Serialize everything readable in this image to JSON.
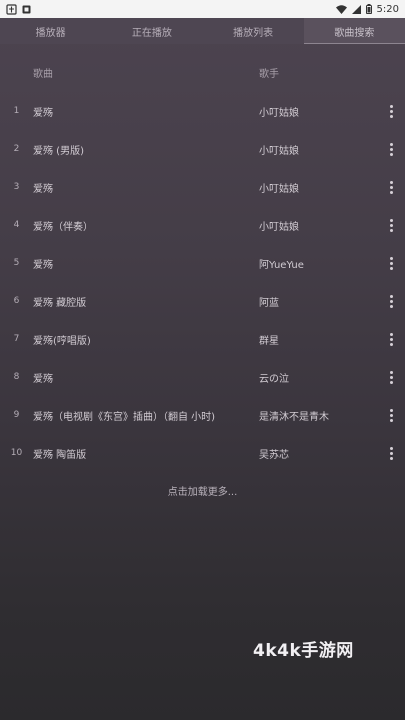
{
  "status": {
    "time": "5:20"
  },
  "tabs": [
    {
      "label": "播放器"
    },
    {
      "label": "正在播放"
    },
    {
      "label": "播放列表"
    },
    {
      "label": "歌曲搜索"
    }
  ],
  "columns": {
    "title": "歌曲",
    "artist": "歌手"
  },
  "rows": [
    {
      "index": "1",
      "title": "爱殇",
      "artist": "小叮姑娘"
    },
    {
      "index": "2",
      "title": "爱殇 (男版)",
      "artist": "小叮姑娘"
    },
    {
      "index": "3",
      "title": "爱殇",
      "artist": "小叮姑娘"
    },
    {
      "index": "4",
      "title": "爱殇（伴奏）",
      "artist": "小叮姑娘"
    },
    {
      "index": "5",
      "title": "爱殇",
      "artist": "阿YueYue"
    },
    {
      "index": "6",
      "title": "爱殇 藏腔版",
      "artist": "阿蓝"
    },
    {
      "index": "7",
      "title": "爱殇(哼唱版)",
      "artist": "群星"
    },
    {
      "index": "8",
      "title": "爱殇",
      "artist": "云の泣"
    },
    {
      "index": "9",
      "title": "爱殇（电视剧《东宫》插曲）（翻自 小时)",
      "artist": "是清沐不是青木"
    },
    {
      "index": "10",
      "title": "爱殇 陶笛版",
      "artist": "吴苏芯"
    }
  ],
  "load_more": "点击加载更多...",
  "watermark": "4k4k手游网"
}
